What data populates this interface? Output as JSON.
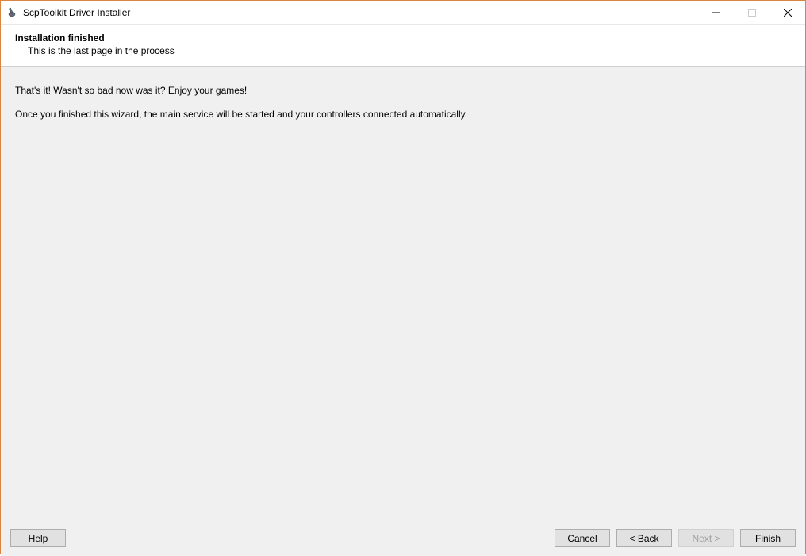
{
  "window": {
    "title": "ScpToolkit Driver Installer"
  },
  "header": {
    "title": "Installation finished",
    "subtitle": "This is the last page in the process"
  },
  "content": {
    "line1": "That's it! Wasn't so bad now was it? Enjoy your games!",
    "line2": "Once you finished this wizard, the main service will be started and your controllers connected automatically."
  },
  "footer": {
    "help_label": "Help",
    "cancel_label": "Cancel",
    "back_label": "< Back",
    "next_label": "Next >",
    "finish_label": "Finish"
  }
}
